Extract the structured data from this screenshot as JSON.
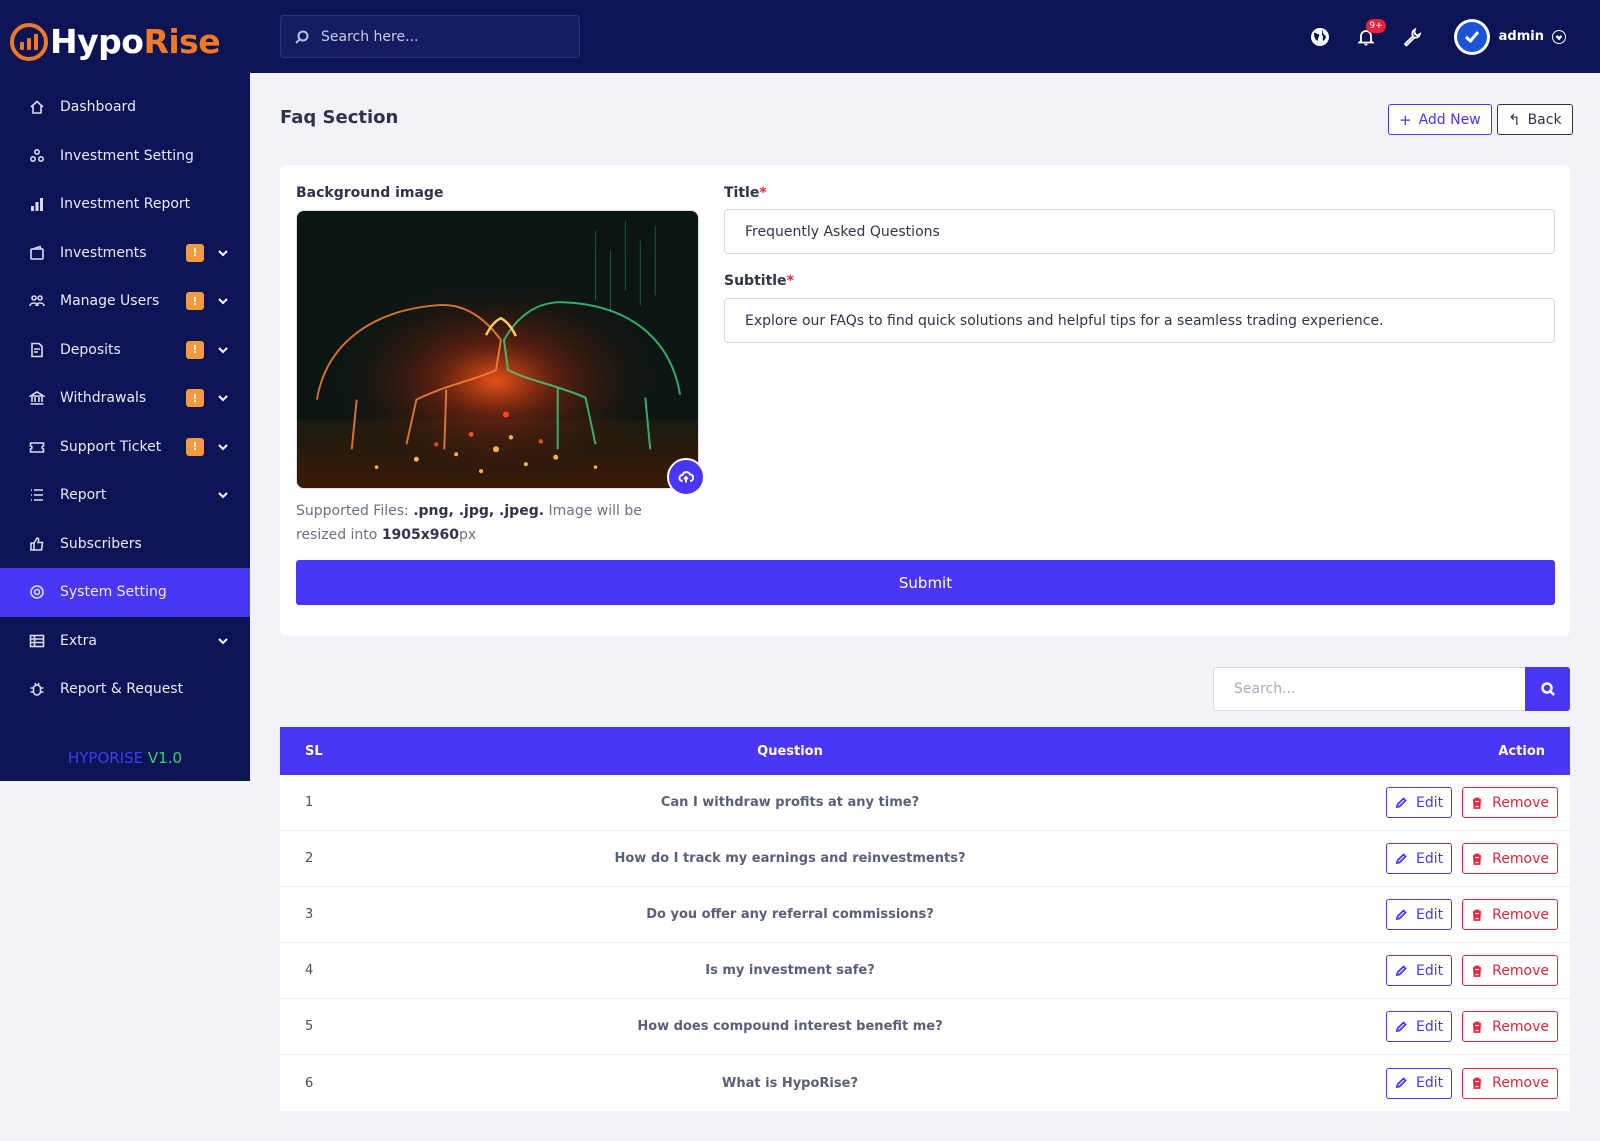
{
  "brand": {
    "part1": "Hypo",
    "part2": "Rise",
    "version_name": "HYPORISE",
    "version_num": "V1.0"
  },
  "sidebar": {
    "items": [
      {
        "label": "Dashboard",
        "icon": "home-icon"
      },
      {
        "label": "Investment Setting",
        "icon": "settings-nodes-icon"
      },
      {
        "label": "Investment Report",
        "icon": "bar-chart-icon"
      },
      {
        "label": "Investments",
        "icon": "wallet-icon",
        "badge": "!"
      },
      {
        "label": "Manage Users",
        "icon": "users-icon",
        "badge": "!"
      },
      {
        "label": "Deposits",
        "icon": "deposit-icon",
        "badge": "!"
      },
      {
        "label": "Withdrawals",
        "icon": "bank-icon",
        "badge": "!"
      },
      {
        "label": "Support Ticket",
        "icon": "ticket-icon",
        "badge": "!"
      },
      {
        "label": "Report",
        "icon": "list-icon"
      },
      {
        "label": "Subscribers",
        "icon": "thumbs-up-icon"
      },
      {
        "label": "System Setting",
        "icon": "gear-icon",
        "active": true
      },
      {
        "label": "Extra",
        "icon": "table-icon"
      },
      {
        "label": "Report & Request",
        "icon": "bug-icon"
      }
    ]
  },
  "topbar": {
    "search_placeholder": "Search here...",
    "notification_count": "9+",
    "user_name": "admin"
  },
  "page": {
    "title": "Faq Section",
    "add_new_label": "Add New",
    "back_label": "Back"
  },
  "form": {
    "bg_label": "Background image",
    "title_label": "Title",
    "title_value": "Frequently Asked Questions",
    "subtitle_label": "Subtitle",
    "subtitle_value": "Explore our FAQs to find quick solutions and helpful tips for a seamless trading experience.",
    "supported_prefix": "Supported Files: ",
    "supported_types": ".png, .jpg, .jpeg.",
    "supported_mid": " Image will be resized into ",
    "supported_size": "1905x960",
    "supported_unit": "px",
    "submit_label": "Submit",
    "required_mark": "*"
  },
  "table": {
    "search_placeholder": "Search...",
    "headers": {
      "sl": "SL",
      "question": "Question",
      "action": "Action"
    },
    "edit_label": "Edit",
    "remove_label": "Remove",
    "rows": [
      {
        "sl": "1",
        "question": "Can I withdraw profits at any time?"
      },
      {
        "sl": "2",
        "question": "How do I track my earnings and reinvestments?"
      },
      {
        "sl": "3",
        "question": "Do you offer any referral commissions?"
      },
      {
        "sl": "4",
        "question": "Is my investment safe?"
      },
      {
        "sl": "5",
        "question": "How does compound interest benefit me?"
      },
      {
        "sl": "6",
        "question": "What is HypoRise?"
      }
    ]
  },
  "colors": {
    "sidebar_bg": "#0d1456",
    "accent": "#4a36f7",
    "brand_orange": "#f07a23",
    "danger": "#e8243a",
    "warning": "#f39a3a"
  }
}
